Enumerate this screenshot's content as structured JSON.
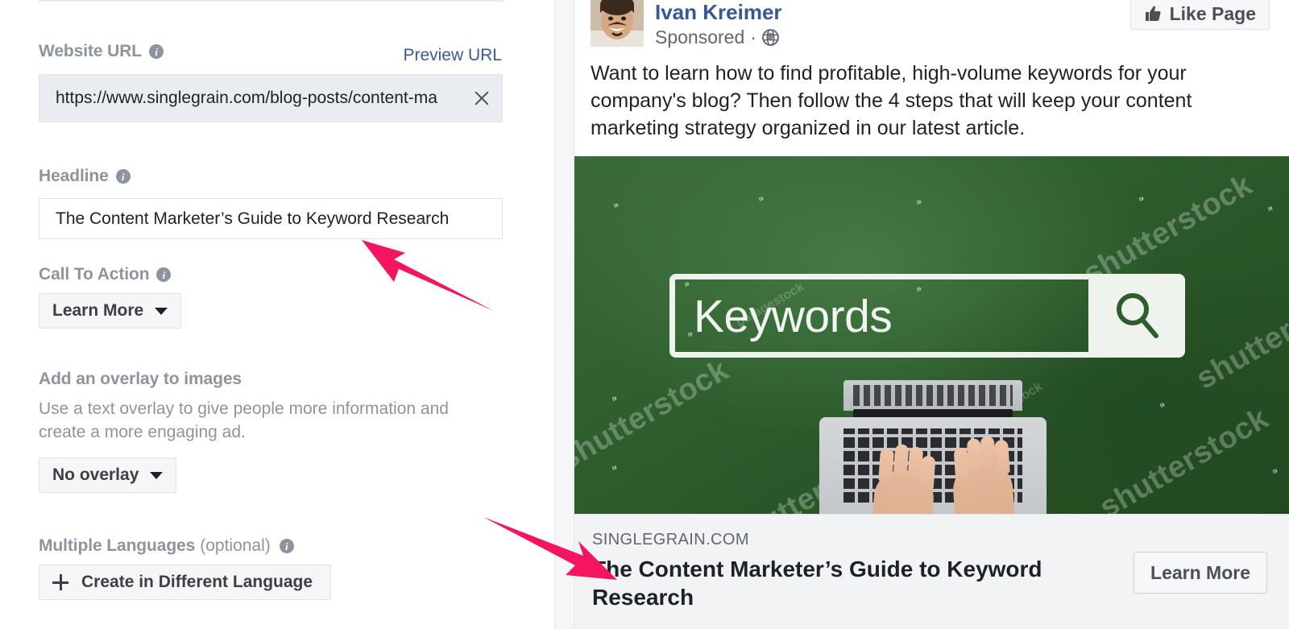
{
  "form": {
    "website_url": {
      "label": "Website URL",
      "info_icon": "info-icon",
      "preview_link": "Preview URL",
      "value": "https://www.singlegrain.com/blog-posts/content-ma",
      "clear_icon": "close-icon"
    },
    "headline": {
      "label": "Headline",
      "info_icon": "info-icon",
      "value": "The Content Marketer’s Guide to Keyword Research"
    },
    "call_to_action": {
      "label": "Call To Action",
      "info_icon": "info-icon",
      "selected": "Learn More",
      "caret_icon": "chevron-down-icon"
    },
    "overlay": {
      "label": "Add an overlay to images",
      "description": "Use a text overlay to give people more information and create a more engaging ad.",
      "selected": "No overlay",
      "caret_icon": "chevron-down-icon"
    },
    "multiple_languages": {
      "label": "Multiple Languages",
      "optional_suffix": "(optional)",
      "info_icon": "info-icon",
      "button_label": "Create in Different Language",
      "plus_icon": "plus-icon"
    }
  },
  "ad_preview": {
    "page_name": "Ivan Kreimer",
    "avatar": "avatar",
    "sponsored_label": "Sponsored",
    "dot_separator": "·",
    "globe_icon": "globe-icon",
    "like_page": {
      "label": "Like Page",
      "icon": "thumbs-up-icon"
    },
    "body_text": "Want to learn how to find profitable, high-volume keywords for your company's blog? Then follow the 4 steps that will keep your content marketing strategy organized in our latest article.",
    "creative": {
      "search_text": "Keywords",
      "search_icon": "magnifier-icon",
      "watermark": "shutterstock",
      "watermark_short": "paragestock"
    },
    "link": {
      "domain": "SINGLEGRAIN.COM",
      "headline": "The Content Marketer’s Guide to Keyword Research",
      "cta_label": "Learn More"
    }
  },
  "annotations": {
    "arrow_color": "#F5145F",
    "arrow_headline": "arrow-pointing-to-headline-field",
    "arrow_ad_headline": "arrow-pointing-to-ad-headline"
  },
  "colors": {
    "link_blue": "#3b5998",
    "label_gray": "#8d949e",
    "text_dark": "#1d2129",
    "panel_gray": "#f5f6f7",
    "accent_pink": "#F5145F"
  }
}
